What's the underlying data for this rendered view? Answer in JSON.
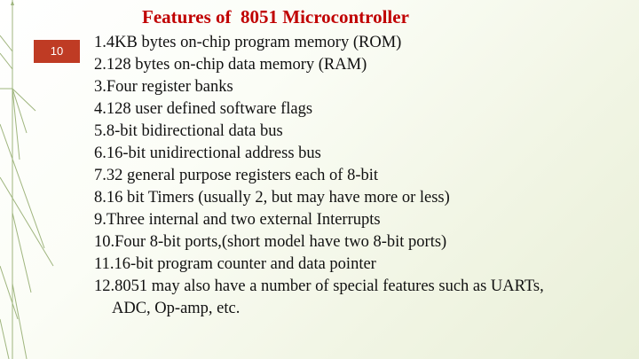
{
  "slide": {
    "number": "10",
    "title": "Features of  8051 Microcontroller",
    "accent_color": "#bf3b24",
    "title_color": "#c00000"
  },
  "items": [
    {
      "num": "1. ",
      "text": "4KB bytes on-chip program memory (ROM)"
    },
    {
      "num": "2. ",
      "text": "128 bytes on-chip data memory (RAM)"
    },
    {
      "num": "3. ",
      "text": "Four register banks"
    },
    {
      "num": "4. ",
      "text": "128 user defined software flags"
    },
    {
      "num": "5. ",
      "text": "8-bit bidirectional data bus"
    },
    {
      "num": "6. ",
      "text": "16-bit unidirectional address bus"
    },
    {
      "num": "7. ",
      "text": "32 general purpose registers each of 8-bit"
    },
    {
      "num": "8. ",
      "text": "16 bit Timers (usually 2, but may have more or less)"
    },
    {
      "num": "9. ",
      "text": "Three internal and two external Interrupts"
    },
    {
      "num": "10.",
      "text": "Four 8-bit ports,(short model have two 8-bit ports)"
    },
    {
      "num": "11.",
      "text": "16-bit program counter and data pointer"
    },
    {
      "num": "12.",
      "text": "8051 may also have a number of special features such as UARTs,",
      "continuation": "ADC, Op-amp, etc."
    }
  ]
}
